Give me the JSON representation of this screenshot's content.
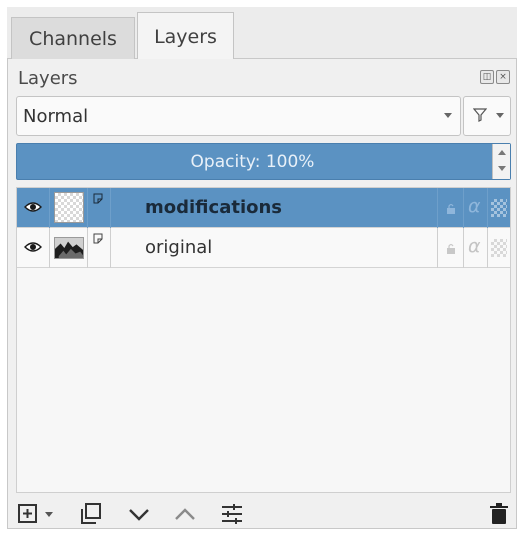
{
  "tabs": [
    {
      "label": "Channels",
      "active": false
    },
    {
      "label": "Layers",
      "active": true
    }
  ],
  "panel": {
    "title": "Layers",
    "title_buttons": [
      "detach-icon",
      "close-icon"
    ]
  },
  "mode": {
    "value": "Normal",
    "filter_icon": "filter-icon"
  },
  "opacity": {
    "label": "Opacity: 100%",
    "value_percent": 100
  },
  "layers": [
    {
      "name": "modifications",
      "visible": true,
      "selected": true,
      "thumbnail": "transparent"
    },
    {
      "name": "original",
      "visible": true,
      "selected": false,
      "thumbnail": "image"
    }
  ],
  "toolbar": [
    "add-layer-icon",
    "duplicate-layer-icon",
    "move-layer-down-icon",
    "move-layer-up-icon",
    "layer-properties-icon",
    "delete-layer-icon"
  ],
  "colors": {
    "accent": "#5b92c2",
    "panel_bg": "#f0f0f0"
  }
}
